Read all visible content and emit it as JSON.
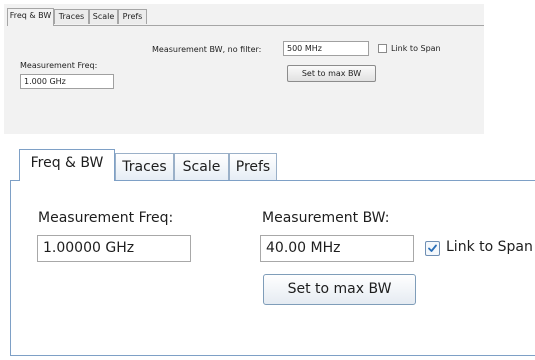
{
  "top_panel": {
    "tabs": [
      {
        "label": "Freq & BW",
        "active": true
      },
      {
        "label": "Traces",
        "active": false
      },
      {
        "label": "Scale",
        "active": false
      },
      {
        "label": "Prefs",
        "active": false
      }
    ],
    "measurement_freq_label": "Measurement Freq:",
    "measurement_freq_value": "1.000 GHz",
    "measurement_bw_label": "Measurement BW, no filter:",
    "measurement_bw_value": "500 MHz",
    "link_to_span_label": "Link to Span",
    "link_to_span_checked": false,
    "set_max_bw_label": "Set to max BW"
  },
  "bottom_panel": {
    "tabs": [
      {
        "label": "Freq & BW",
        "active": true
      },
      {
        "label": "Traces",
        "active": false
      },
      {
        "label": "Scale",
        "active": false
      },
      {
        "label": "Prefs",
        "active": false
      }
    ],
    "measurement_freq_label": "Measurement Freq:",
    "measurement_freq_value": "1.00000 GHz",
    "measurement_bw_label": "Measurement BW:",
    "measurement_bw_value": "40.00 MHz",
    "link_to_span_label": "Link to Span",
    "link_to_span_checked": true,
    "set_max_bw_label": "Set to max BW"
  },
  "colors": {
    "top_panel_bg": "#f2f2f2",
    "accent_border": "#7ea0c6",
    "checkmark": "#2a6fb8"
  },
  "icons": [
    "checkbox-icon",
    "checkmark-icon"
  ]
}
